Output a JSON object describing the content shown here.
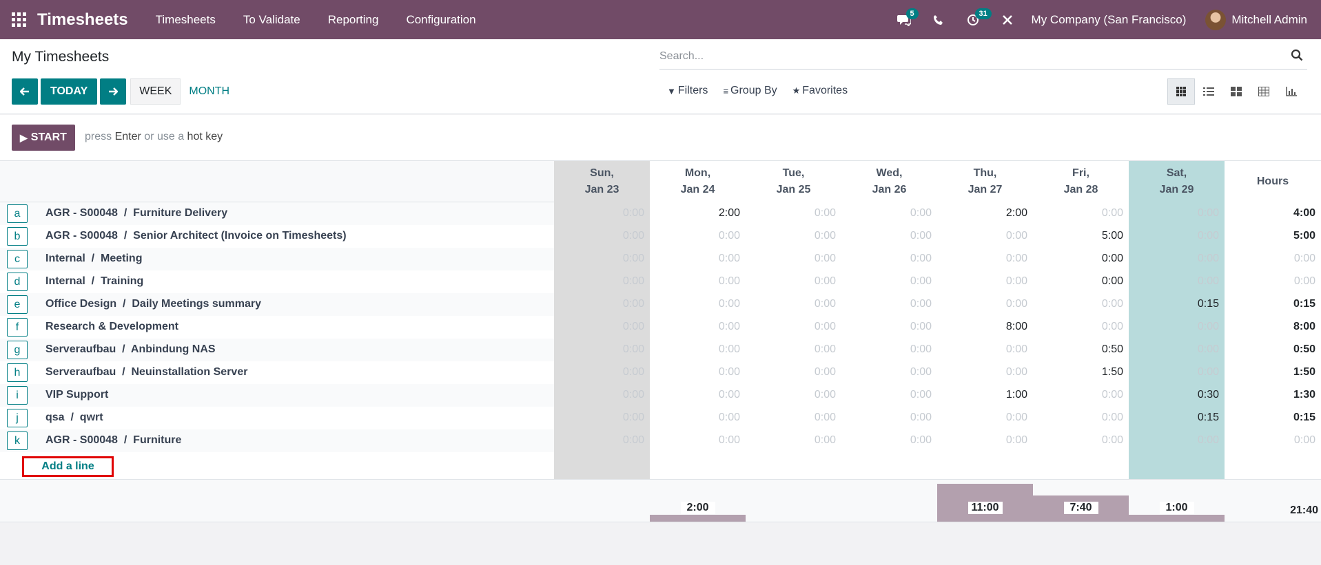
{
  "navbar": {
    "brand": "Timesheets",
    "menu": [
      "Timesheets",
      "To Validate",
      "Reporting",
      "Configuration"
    ],
    "messages_count": "5",
    "activities_count": "31",
    "company": "My Company (San Francisco)",
    "user": "Mitchell Admin"
  },
  "control_panel": {
    "title": "My Timesheets",
    "search_placeholder": "Search...",
    "today_label": "TODAY",
    "week_label": "WEEK",
    "month_label": "MONTH",
    "filters_label": "Filters",
    "groupby_label": "Group By",
    "favorites_label": "Favorites"
  },
  "start_bar": {
    "start_label": "START",
    "hint_prefix": "press",
    "hint_key1": "Enter",
    "hint_middle": "or use a",
    "hint_key2": "hot key"
  },
  "grid": {
    "days": [
      {
        "dow": "Sun,",
        "date": "Jan 23"
      },
      {
        "dow": "Mon,",
        "date": "Jan 24"
      },
      {
        "dow": "Tue,",
        "date": "Jan 25"
      },
      {
        "dow": "Wed,",
        "date": "Jan 26"
      },
      {
        "dow": "Thu,",
        "date": "Jan 27"
      },
      {
        "dow": "Fri,",
        "date": "Jan 28"
      },
      {
        "dow": "Sat,",
        "date": "Jan 29"
      }
    ],
    "hours_header": "Hours",
    "rows": [
      {
        "key": "a",
        "label": "AGR - S00048  /  Furniture Delivery",
        "values": [
          "0:00",
          "2:00",
          "0:00",
          "0:00",
          "2:00",
          "0:00",
          "0:00"
        ],
        "total": "4:00"
      },
      {
        "key": "b",
        "label": "AGR - S00048  /  Senior Architect (Invoice on Timesheets)",
        "values": [
          "0:00",
          "0:00",
          "0:00",
          "0:00",
          "0:00",
          "5:00",
          "0:00"
        ],
        "total": "5:00"
      },
      {
        "key": "c",
        "label": "Internal  /  Meeting",
        "values": [
          "0:00",
          "0:00",
          "0:00",
          "0:00",
          "0:00",
          "0:00",
          "0:00"
        ],
        "total": "0:00",
        "dark": [
          5
        ]
      },
      {
        "key": "d",
        "label": "Internal  /  Training",
        "values": [
          "0:00",
          "0:00",
          "0:00",
          "0:00",
          "0:00",
          "0:00",
          "0:00"
        ],
        "total": "0:00",
        "dark": [
          5
        ]
      },
      {
        "key": "e",
        "label": "Office Design  /  Daily Meetings summary",
        "values": [
          "0:00",
          "0:00",
          "0:00",
          "0:00",
          "0:00",
          "0:00",
          "0:15"
        ],
        "total": "0:15"
      },
      {
        "key": "f",
        "label": "Research & Development",
        "values": [
          "0:00",
          "0:00",
          "0:00",
          "0:00",
          "8:00",
          "0:00",
          "0:00"
        ],
        "total": "8:00"
      },
      {
        "key": "g",
        "label": "Serveraufbau  /  Anbindung NAS",
        "values": [
          "0:00",
          "0:00",
          "0:00",
          "0:00",
          "0:00",
          "0:50",
          "0:00"
        ],
        "total": "0:50"
      },
      {
        "key": "h",
        "label": "Serveraufbau  /  Neuinstallation Server",
        "values": [
          "0:00",
          "0:00",
          "0:00",
          "0:00",
          "0:00",
          "1:50",
          "0:00"
        ],
        "total": "1:50"
      },
      {
        "key": "i",
        "label": "VIP Support",
        "values": [
          "0:00",
          "0:00",
          "0:00",
          "0:00",
          "1:00",
          "0:00",
          "0:30"
        ],
        "total": "1:30"
      },
      {
        "key": "j",
        "label": "qsa  /  qwrt",
        "values": [
          "0:00",
          "0:00",
          "0:00",
          "0:00",
          "0:00",
          "0:00",
          "0:15"
        ],
        "total": "0:15"
      },
      {
        "key": "k",
        "label": "AGR - S00048  /  Furniture",
        "values": [
          "0:00",
          "0:00",
          "0:00",
          "0:00",
          "0:00",
          "0:00",
          "0:00"
        ],
        "total": "0:00"
      }
    ],
    "add_line_label": "Add a line",
    "day_totals": [
      "",
      "2:00",
      "",
      "",
      "11:00",
      "7:40",
      "1:00"
    ],
    "day_totals_hours": [
      0,
      2,
      0,
      0,
      11,
      7.667,
      1
    ],
    "grand_total": "21:40"
  },
  "colors": {
    "brand": "#714b67",
    "accent": "#017e84",
    "today_column": "#b8dbdc",
    "weekend_column": "#dcdcdc",
    "total_bar": "#b3a0ae",
    "highlight_box": "#e00000"
  }
}
